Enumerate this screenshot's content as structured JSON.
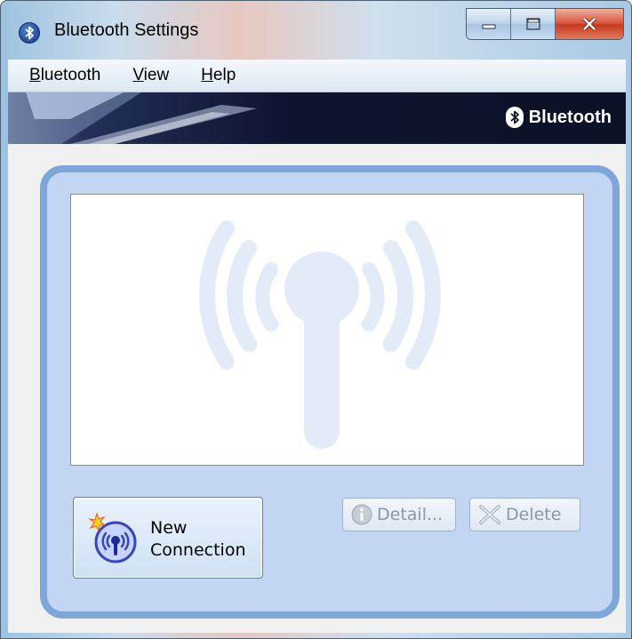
{
  "window": {
    "title": "Bluetooth Settings",
    "caption_buttons": [
      "minimize",
      "maximize",
      "close"
    ]
  },
  "menu": [
    {
      "label_ul": "B",
      "label_rest": "luetooth"
    },
    {
      "label_ul": "V",
      "label_rest": "iew"
    },
    {
      "label_ul": "H",
      "label_rest": "elp"
    }
  ],
  "banner": {
    "logo_text": "Bluetooth"
  },
  "main": {
    "new_connection_line1": "New",
    "new_connection_line2": "Connection",
    "detail_label": "Detail...",
    "delete_label": "Delete"
  },
  "colors": {
    "panel_fill": "#c2d6f3",
    "panel_border": "#7ea6d8",
    "watermark": "#e2ebf7",
    "close_red": "#c53a1e"
  }
}
